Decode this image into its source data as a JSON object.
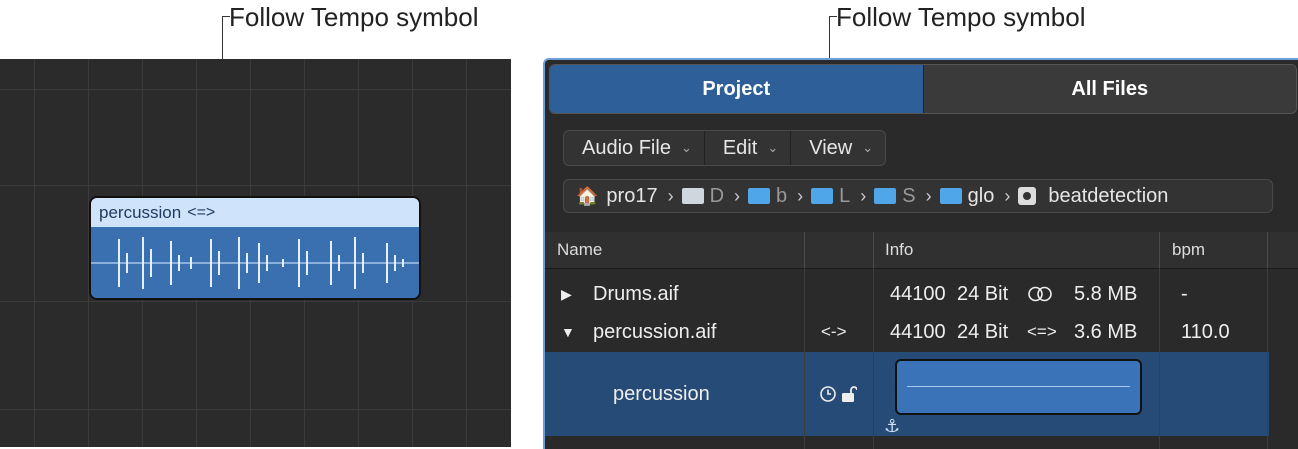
{
  "callouts": {
    "left": "Follow Tempo symbol",
    "right": "Follow Tempo symbol"
  },
  "region": {
    "name": "percussion",
    "follow_tempo_symbol": "<=>"
  },
  "browser": {
    "tabs": [
      {
        "label": "Project",
        "active": true
      },
      {
        "label": "All Files",
        "active": false
      }
    ],
    "menus": [
      {
        "label": "Audio File",
        "chevron": "chevron-down-icon"
      },
      {
        "label": "Edit",
        "chevron": "chevron-down-icon"
      },
      {
        "label": "View",
        "chevron": "chevron-down-icon"
      }
    ],
    "path": [
      {
        "label": "pro17",
        "icon": "home-icon"
      },
      {
        "label": "D",
        "icon": "folder-icon",
        "color": "#cfd6de"
      },
      {
        "label": "b",
        "icon": "folder-icon",
        "color": "#4fa6e8"
      },
      {
        "label": "L",
        "icon": "folder-icon",
        "color": "#4fa6e8"
      },
      {
        "label": "S",
        "icon": "folder-icon",
        "color": "#4fa6e8"
      },
      {
        "label": "glo",
        "icon": "folder-icon",
        "color": "#4fa6e8"
      },
      {
        "label": "beatdetection",
        "icon": "disk-icon"
      }
    ],
    "columns": {
      "name": "Name",
      "info": "Info",
      "bpm": "bpm"
    },
    "rows": [
      {
        "name": "Drums.aif",
        "expanded": false,
        "flag": "",
        "rate": "44100",
        "bits": "24 Bit",
        "channel_icon": "stereo-icon",
        "size": "5.8 MB",
        "bpm": "-"
      },
      {
        "name": "percussion.aif",
        "expanded": true,
        "flag": "<->",
        "rate": "44100",
        "bits": "24 Bit",
        "channel_symbol": "<=>",
        "size": "3.6 MB",
        "bpm": "110.0"
      }
    ],
    "region_row": {
      "name": "percussion",
      "icons": [
        "clock-icon",
        "lock-open-icon"
      ],
      "anchor_icon": "anchor-icon"
    }
  },
  "colors": {
    "accent": "#2f5f98",
    "selection": "#264b76",
    "region_header": "#cfe3fb",
    "region_body": "#3a6fb0"
  }
}
